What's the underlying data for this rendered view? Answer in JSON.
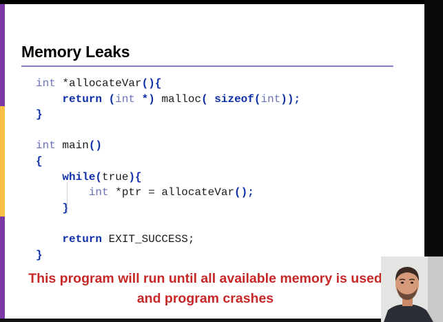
{
  "slide": {
    "title": "Memory Leaks",
    "code_lines": [
      [
        {
          "t": "int ",
          "c": "type"
        },
        {
          "t": "*allocateVar",
          "c": "plain"
        },
        {
          "t": "(){",
          "c": "punc"
        }
      ],
      [
        {
          "t": "    ",
          "c": "plain"
        },
        {
          "t": "return",
          "c": "kw"
        },
        {
          "t": " (",
          "c": "punc"
        },
        {
          "t": "int",
          "c": "type"
        },
        {
          "t": " *)",
          "c": "punc"
        },
        {
          "t": " malloc",
          "c": "plain"
        },
        {
          "t": "( ",
          "c": "punc"
        },
        {
          "t": "sizeof",
          "c": "kw"
        },
        {
          "t": "(",
          "c": "punc"
        },
        {
          "t": "int",
          "c": "type"
        },
        {
          "t": "));",
          "c": "punc"
        }
      ],
      [
        {
          "t": "}",
          "c": "punc"
        }
      ],
      [],
      [
        {
          "t": "int ",
          "c": "type"
        },
        {
          "t": "main",
          "c": "plain"
        },
        {
          "t": "()",
          "c": "punc"
        }
      ],
      [
        {
          "t": "{",
          "c": "punc"
        }
      ],
      [
        {
          "t": "    ",
          "c": "plain"
        },
        {
          "t": "while",
          "c": "kw"
        },
        {
          "t": "(",
          "c": "punc"
        },
        {
          "t": "true",
          "c": "plain"
        },
        {
          "t": "){",
          "c": "punc"
        }
      ],
      [
        {
          "t": "        ",
          "c": "plain"
        },
        {
          "t": "int ",
          "c": "type"
        },
        {
          "t": "*ptr = allocateVar",
          "c": "plain"
        },
        {
          "t": "();",
          "c": "punc"
        }
      ],
      [
        {
          "t": "    ",
          "c": "plain"
        },
        {
          "t": "}",
          "c": "punc"
        }
      ],
      [],
      [
        {
          "t": "    ",
          "c": "plain"
        },
        {
          "t": "return",
          "c": "kw"
        },
        {
          "t": " EXIT_SUCCESS;",
          "c": "plain"
        }
      ],
      [
        {
          "t": "}",
          "c": "punc"
        }
      ]
    ],
    "warning_line1": "This program will run until all available memory is used",
    "warning_line2": "and program crashes"
  },
  "colors": {
    "accent_purple": "#7b3aa6",
    "accent_yellow": "#f8c146",
    "title_rule": "#8e7cc3",
    "keyword": "#0f2fa8",
    "type": "#6a73b8",
    "warning": "#c62828"
  },
  "icons": {
    "presenter": "presenter-webcam-person"
  }
}
